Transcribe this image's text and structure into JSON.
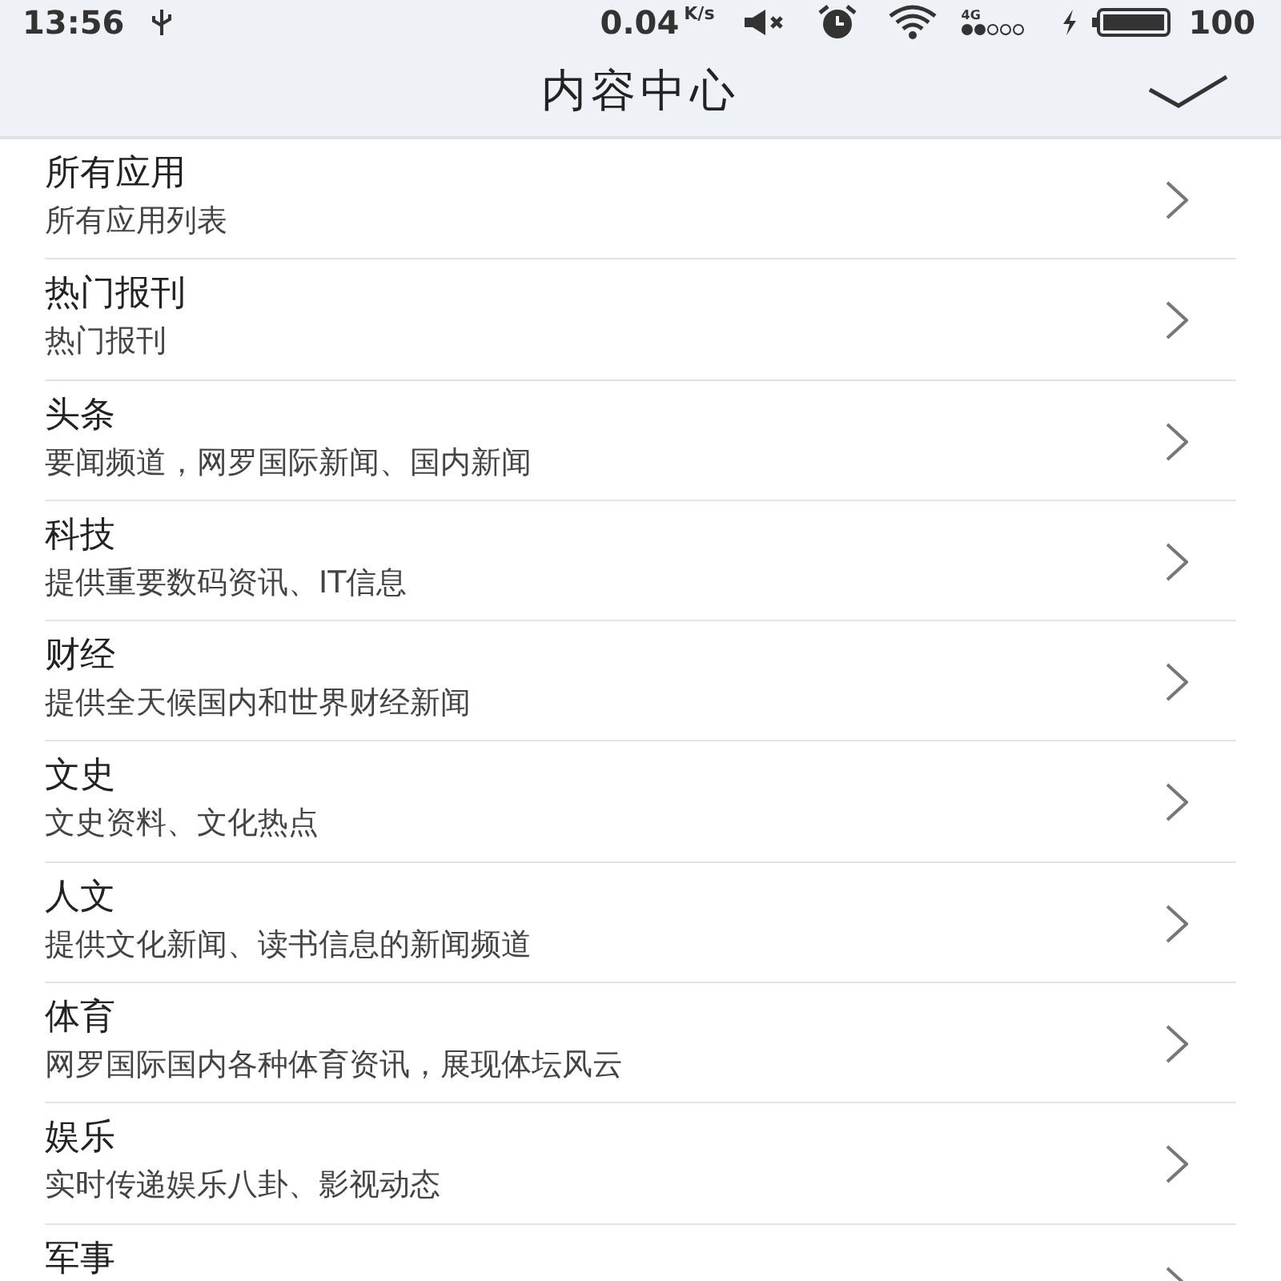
{
  "status_bar": {
    "time": "13:56",
    "speed": "0.04",
    "speed_unit": "K/s",
    "network": "4G",
    "battery": "100"
  },
  "header": {
    "title": "内容中心"
  },
  "items": [
    {
      "title": "所有应用",
      "subtitle": "所有应用列表"
    },
    {
      "title": "热门报刊",
      "subtitle": "热门报刊"
    },
    {
      "title": "头条",
      "subtitle": "要闻频道，网罗国际新闻、国内新闻"
    },
    {
      "title": "科技",
      "subtitle": "提供重要数码资讯、IT信息"
    },
    {
      "title": "财经",
      "subtitle": "提供全天候国内和世界财经新闻"
    },
    {
      "title": "文史",
      "subtitle": "文史资料、文化热点"
    },
    {
      "title": "人文",
      "subtitle": "提供文化新闻、读书信息的新闻频道"
    },
    {
      "title": "体育",
      "subtitle": "网罗国际国内各种体育资讯，展现体坛风云"
    },
    {
      "title": "娱乐",
      "subtitle": "实时传递娱乐八卦、影视动态"
    },
    {
      "title": "军事"
    }
  ]
}
